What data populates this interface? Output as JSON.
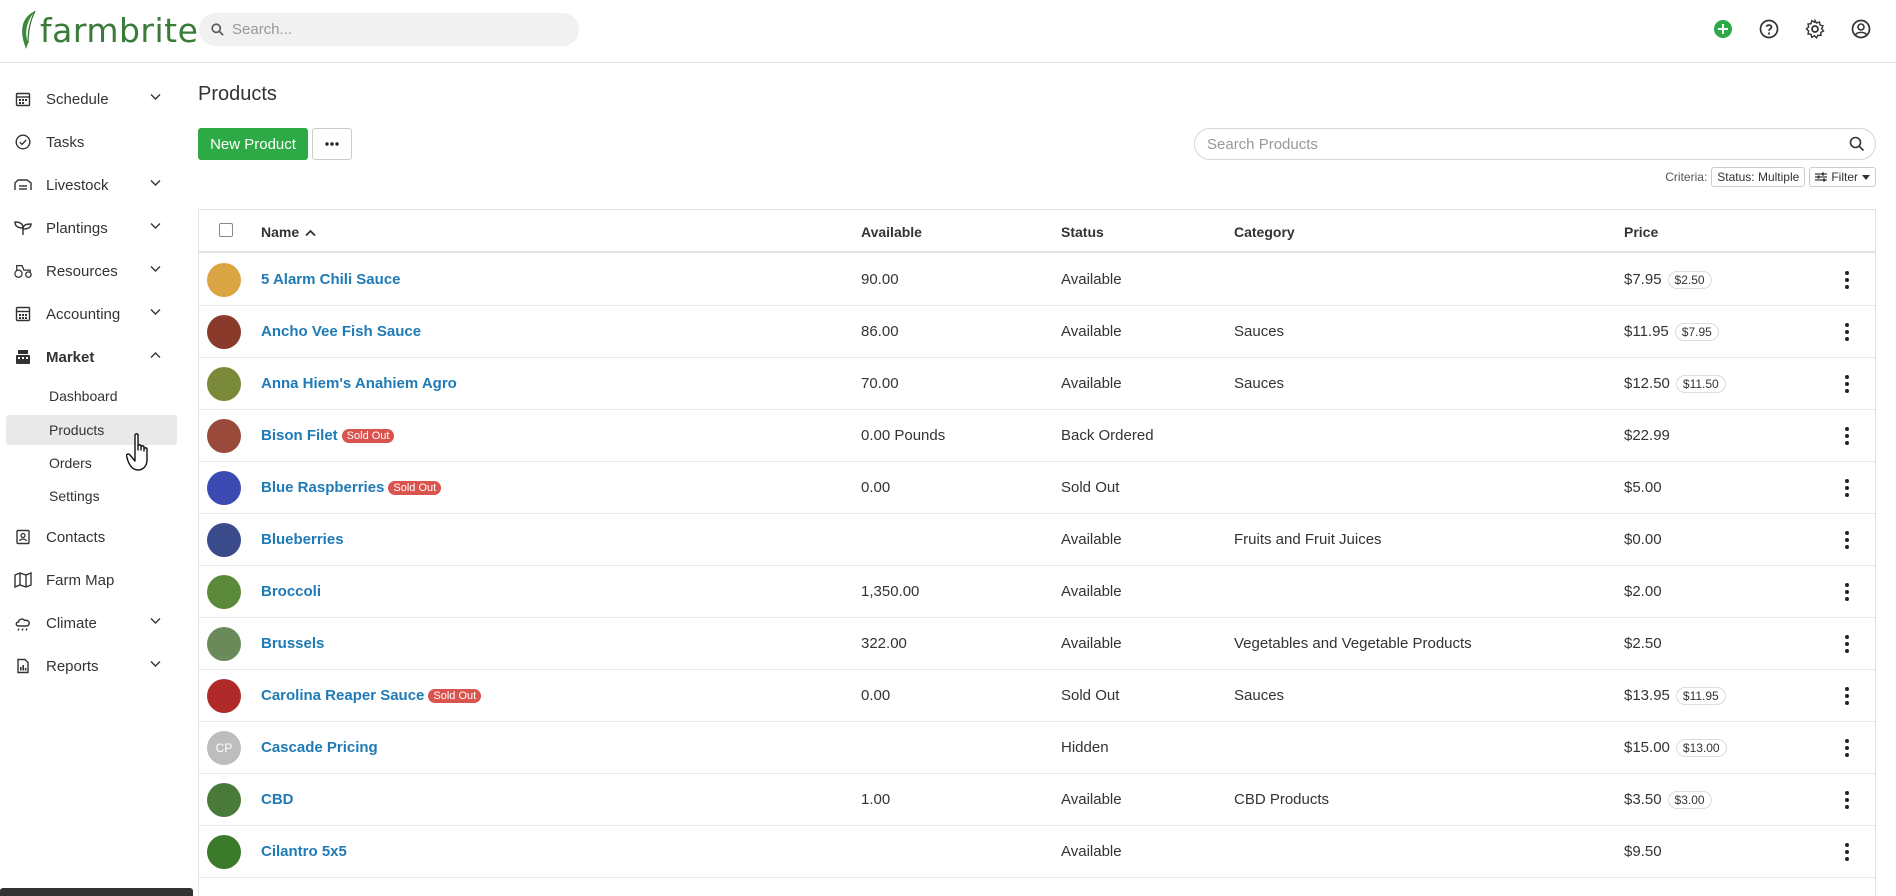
{
  "app": {
    "logo_text": "farmbrite",
    "search_placeholder": "Search...",
    "top_icons": [
      "plus-circle-icon",
      "help-icon",
      "gear-icon",
      "user-icon"
    ],
    "accent": "#2da946"
  },
  "sidebar": {
    "items": [
      {
        "label": "Schedule",
        "icon": "calendar-icon",
        "chevron": "down"
      },
      {
        "label": "Tasks",
        "icon": "check-circle-icon",
        "chevron": ""
      },
      {
        "label": "Livestock",
        "icon": "livestock-icon",
        "chevron": "down"
      },
      {
        "label": "Plantings",
        "icon": "sprout-icon",
        "chevron": "down"
      },
      {
        "label": "Resources",
        "icon": "tractor-icon",
        "chevron": "down"
      },
      {
        "label": "Accounting",
        "icon": "calculator-icon",
        "chevron": "down"
      },
      {
        "label": "Market",
        "icon": "register-icon",
        "chevron": "up"
      }
    ],
    "market_sub": [
      "Dashboard",
      "Products",
      "Orders",
      "Settings"
    ],
    "active_sub": "Products",
    "items_after": [
      {
        "label": "Contacts",
        "icon": "contacts-icon",
        "chevron": ""
      },
      {
        "label": "Farm Map",
        "icon": "map-icon",
        "chevron": ""
      },
      {
        "label": "Climate",
        "icon": "cloud-icon",
        "chevron": "down"
      },
      {
        "label": "Reports",
        "icon": "report-icon",
        "chevron": "down"
      }
    ]
  },
  "main": {
    "title": "Products",
    "new_button": "New Product",
    "search_placeholder": "Search Products",
    "criteria_label": "Criteria:",
    "criteria_value": "Status: Multiple",
    "filter_label": "Filter"
  },
  "table": {
    "columns": [
      "Name",
      "Available",
      "Status",
      "Category",
      "Price"
    ],
    "sold_out_label": "Sold Out",
    "rows": [
      {
        "name": "5 Alarm Chili Sauce",
        "sold_out": false,
        "available": "90.00",
        "status": "Available",
        "category": "",
        "price": "$7.95",
        "sale": "$2.50",
        "thumb": "#d9a441"
      },
      {
        "name": "Ancho Vee Fish Sauce",
        "sold_out": false,
        "available": "86.00",
        "status": "Available",
        "category": "Sauces",
        "price": "$11.95",
        "sale": "$7.95",
        "thumb": "#8a3a2a"
      },
      {
        "name": "Anna Hiem's Anahiem Agro",
        "sold_out": false,
        "available": "70.00",
        "status": "Available",
        "category": "Sauces",
        "price": "$12.50",
        "sale": "$11.50",
        "thumb": "#7a8a3a"
      },
      {
        "name": "Bison Filet",
        "sold_out": true,
        "available": "0.00 Pounds",
        "status": "Back Ordered",
        "category": "",
        "price": "$22.99",
        "sale": "",
        "thumb": "#9a4a3a"
      },
      {
        "name": "Blue Raspberries",
        "sold_out": true,
        "available": "0.00",
        "status": "Sold Out",
        "category": "",
        "price": "$5.00",
        "sale": "",
        "thumb": "#3a4ab0"
      },
      {
        "name": "Blueberries",
        "sold_out": false,
        "available": "",
        "status": "Available",
        "category": "Fruits and Fruit Juices",
        "price": "$0.00",
        "sale": "",
        "thumb": "#3a4a8a"
      },
      {
        "name": "Broccoli",
        "sold_out": false,
        "available": "1,350.00",
        "status": "Available",
        "category": "",
        "price": "$2.00",
        "sale": "",
        "thumb": "#5a8a3a"
      },
      {
        "name": "Brussels",
        "sold_out": false,
        "available": "322.00",
        "status": "Available",
        "category": "Vegetables and Vegetable Products",
        "price": "$2.50",
        "sale": "",
        "thumb": "#6a8a5a"
      },
      {
        "name": "Carolina Reaper Sauce",
        "sold_out": true,
        "available": "0.00",
        "status": "Sold Out",
        "category": "Sauces",
        "price": "$13.95",
        "sale": "$11.95",
        "thumb": "#b02a2a"
      },
      {
        "name": "Cascade Pricing",
        "sold_out": false,
        "available": "",
        "status": "Hidden",
        "category": "",
        "price": "$15.00",
        "sale": "$13.00",
        "thumb": "",
        "initials": "CP"
      },
      {
        "name": "CBD",
        "sold_out": false,
        "available": "1.00",
        "status": "Available",
        "category": "CBD Products",
        "price": "$3.50",
        "sale": "$3.00",
        "thumb": "#4a7a3a"
      },
      {
        "name": "Cilantro 5x5",
        "sold_out": false,
        "available": "",
        "status": "Available",
        "category": "",
        "price": "$9.50",
        "sale": "",
        "thumb": "#3a7a2a"
      }
    ]
  }
}
